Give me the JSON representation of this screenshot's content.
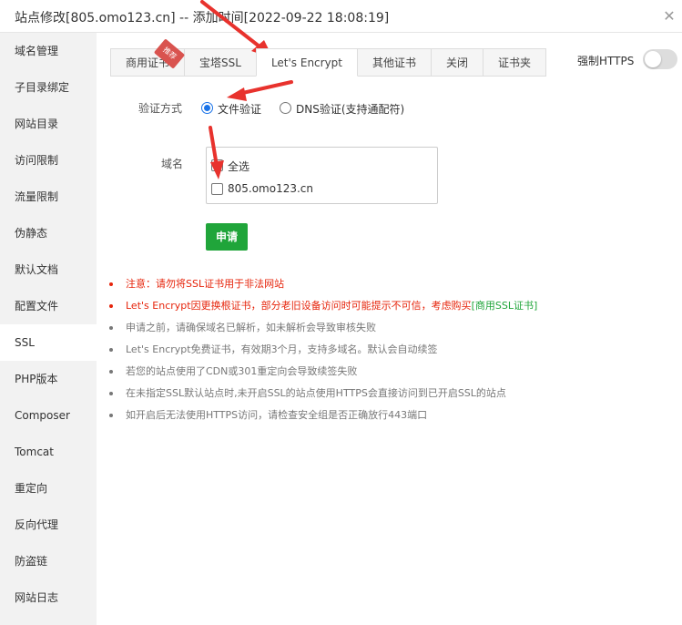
{
  "window": {
    "title": "站点修改[805.omo123.cn] -- 添加时间[2022-09-22 18:08:19]",
    "close_symbol": "✕"
  },
  "sidebar": {
    "items": [
      {
        "label": "域名管理"
      },
      {
        "label": "子目录绑定"
      },
      {
        "label": "网站目录"
      },
      {
        "label": "访问限制"
      },
      {
        "label": "流量限制"
      },
      {
        "label": "伪静态"
      },
      {
        "label": "默认文档"
      },
      {
        "label": "配置文件"
      },
      {
        "label": "SSL",
        "active": true
      },
      {
        "label": "PHP版本"
      },
      {
        "label": "Composer"
      },
      {
        "label": "Tomcat"
      },
      {
        "label": "重定向"
      },
      {
        "label": "反向代理"
      },
      {
        "label": "防盗链"
      },
      {
        "label": "网站日志"
      }
    ]
  },
  "tabs": {
    "items": [
      {
        "label": "商用证书"
      },
      {
        "label": "宝塔SSL"
      },
      {
        "label": "Let's Encrypt",
        "active": true
      },
      {
        "label": "其他证书"
      },
      {
        "label": "关闭"
      },
      {
        "label": "证书夹"
      }
    ],
    "ribbon": "推荐"
  },
  "force_https": {
    "label": "强制HTTPS",
    "enabled": false
  },
  "verify": {
    "label": "验证方式",
    "options": [
      {
        "label": "文件验证",
        "checked": true
      },
      {
        "label": "DNS验证(支持通配符)",
        "checked": false
      }
    ]
  },
  "domains": {
    "label": "域名",
    "select_all": "全选",
    "items": [
      {
        "name": "805.omo123.cn",
        "checked": false
      }
    ]
  },
  "apply_button": "申请",
  "notes": [
    {
      "text": "注意：请勿将SSL证书用于非法网站",
      "color": "#e6240b"
    },
    {
      "text": "Let's Encrypt因更换根证书，部分老旧设备访问时可能提示不可信，考虑购买",
      "link": "[商用SSL证书]",
      "color": "#e6240b"
    },
    {
      "text": "申请之前，请确保域名已解析，如未解析会导致审核失败"
    },
    {
      "text": "Let's Encrypt免费证书，有效期3个月，支持多域名。默认会自动续签"
    },
    {
      "text": "若您的站点使用了CDN或301重定向会导致续签失败"
    },
    {
      "text": "在未指定SSL默认站点时,未开启SSL的站点使用HTTPS会直接访问到已开启SSL的站点"
    },
    {
      "text": "如开启后无法使用HTTPS访问，请检查安全组是否正确放行443端口"
    }
  ],
  "colors": {
    "accent_green": "#20a53a",
    "warning_red": "#e6240b",
    "annotation_arrow": "#e8322d",
    "radio_blue": "#1a73e8"
  }
}
